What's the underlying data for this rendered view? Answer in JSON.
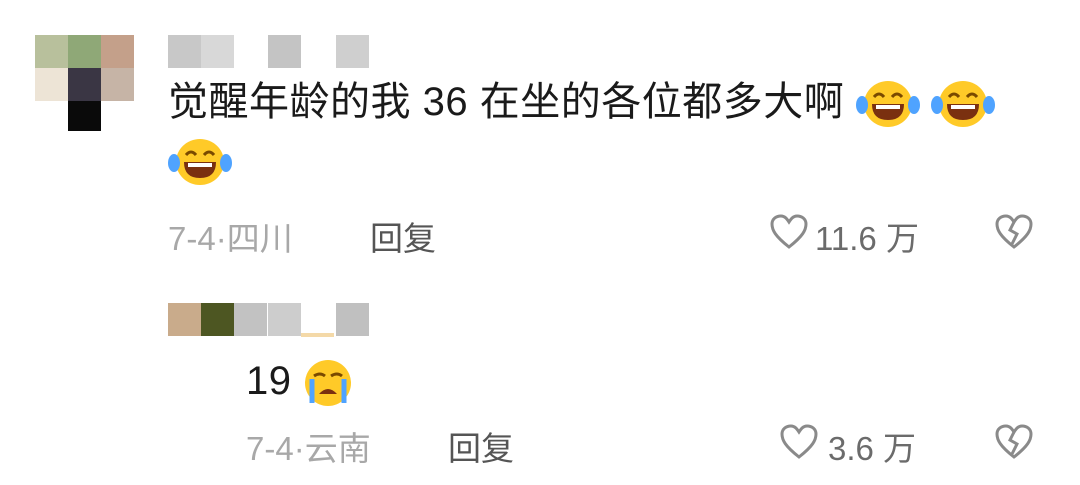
{
  "comments": [
    {
      "text_before": "觉醒年龄的我 36 在坐的各位都多大啊",
      "emoji_icon": "laughing-tears-icon",
      "emoji_count": 3,
      "date": "7-4",
      "separator": "·",
      "location": "四川",
      "reply_label": "回复",
      "like_count": "11.6 万"
    },
    {
      "text": "19",
      "emoji_icon": "crying-face-icon",
      "date": "7-4",
      "separator": "·",
      "location": "云南",
      "reply_label": "回复",
      "like_count": "3.6 万"
    }
  ],
  "colors": {
    "text": "#1a1a1a",
    "meta": "#a8a8a8",
    "emoji_yellow": "#ffca28"
  }
}
